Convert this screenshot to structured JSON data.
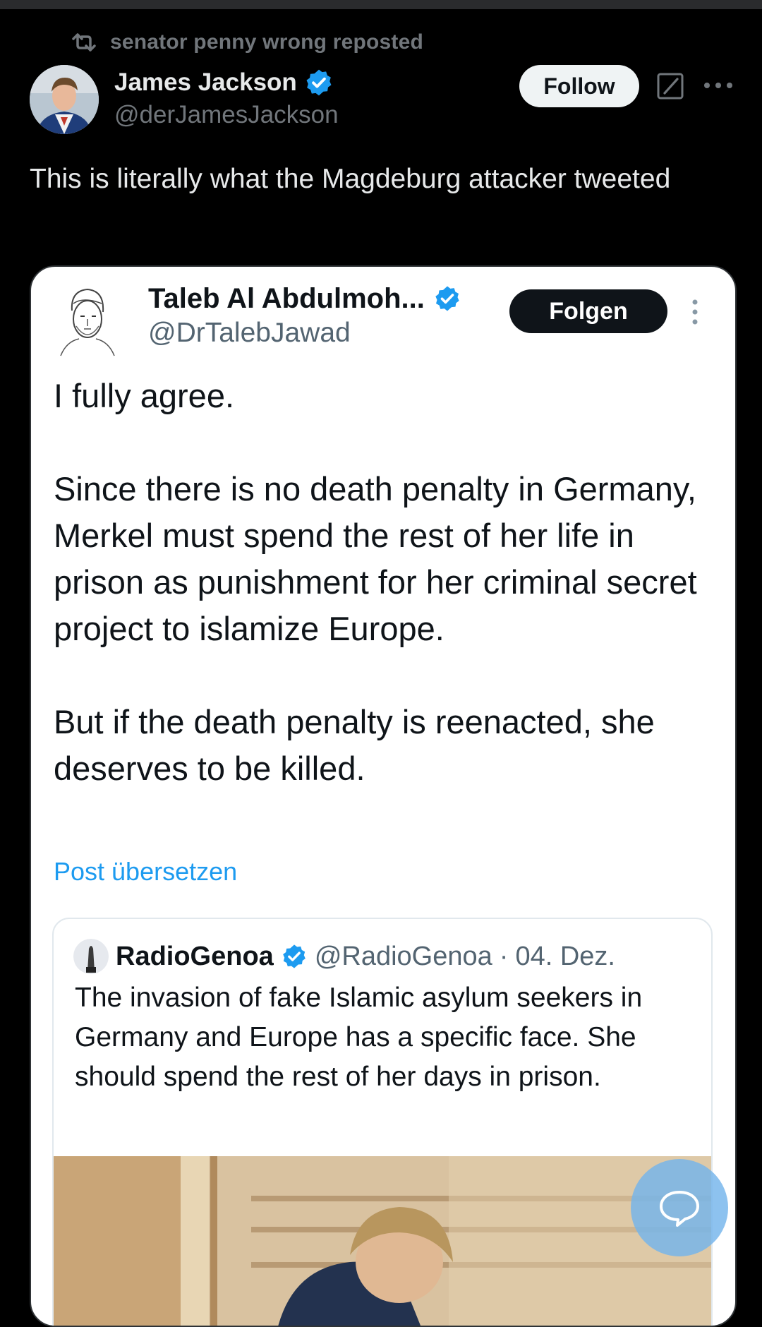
{
  "repost": {
    "text": "senator penny wrong reposted",
    "icon": "repost-icon"
  },
  "author": {
    "name": "James Jackson",
    "handle": "@derJamesJackson",
    "verified": true,
    "follow_label": "Follow"
  },
  "post": {
    "text": "This is literally what the Magdeburg attacker tweeted"
  },
  "embedded_tweet": {
    "name": "Taleb Al Abdulmoh...",
    "handle": "@DrTalebJawad",
    "verified": true,
    "follow_label": "Folgen",
    "body": "I fully agree.\n\nSince there is no death penalty in Germany, Merkel must spend the rest of her life in prison as punishment for her criminal secret project to islamize Europe.\n\nBut if the death penalty is reenacted, she deserves to be killed.",
    "translate_label": "Post übersetzen",
    "quoted": {
      "name": "RadioGenoa",
      "handle": "@RadioGenoa",
      "separator": "·",
      "date": "04. Dez.",
      "body": "The invasion of fake Islamic asylum seekers in Germany and Europe has a specific face. She should spend the rest of her days in prison."
    }
  },
  "colors": {
    "background": "#000000",
    "accent": "#1d9bf0",
    "secondary_text": "#71767b",
    "fab": "#74b4eb"
  },
  "icons": [
    "repost-icon",
    "verified-badge-icon",
    "grok-icon",
    "more-horizontal-icon",
    "more-vertical-icon",
    "chat-bubble-icon"
  ]
}
